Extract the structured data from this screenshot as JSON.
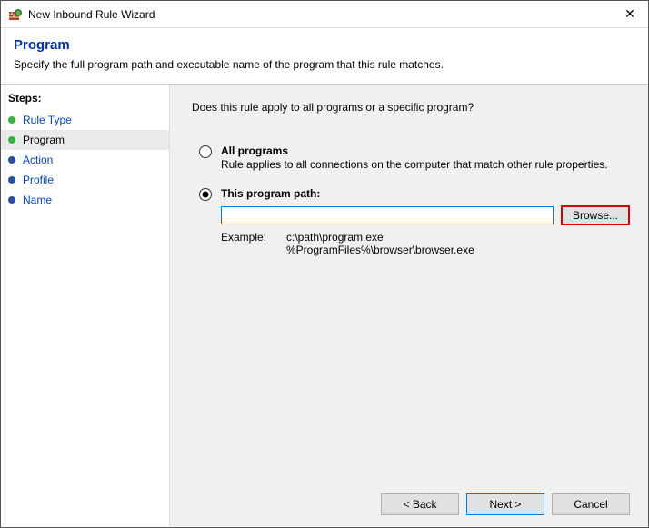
{
  "window": {
    "title": "New Inbound Rule Wizard"
  },
  "header": {
    "title": "Program",
    "subtitle": "Specify the full program path and executable name of the program that this rule matches."
  },
  "sidebar": {
    "label": "Steps:",
    "items": [
      {
        "label": "Rule Type"
      },
      {
        "label": "Program"
      },
      {
        "label": "Action"
      },
      {
        "label": "Profile"
      },
      {
        "label": "Name"
      }
    ]
  },
  "main": {
    "question": "Does this rule apply to all programs or a specific program?",
    "option_all": {
      "title": "All programs",
      "desc": "Rule applies to all connections on the computer that match other rule properties."
    },
    "option_path": {
      "title": "This program path:",
      "value": "",
      "browse": "Browse...",
      "example_label": "Example:",
      "example_body": "c:\\path\\program.exe\n%ProgramFiles%\\browser\\browser.exe"
    }
  },
  "footer": {
    "back": "< Back",
    "next": "Next >",
    "cancel": "Cancel"
  }
}
